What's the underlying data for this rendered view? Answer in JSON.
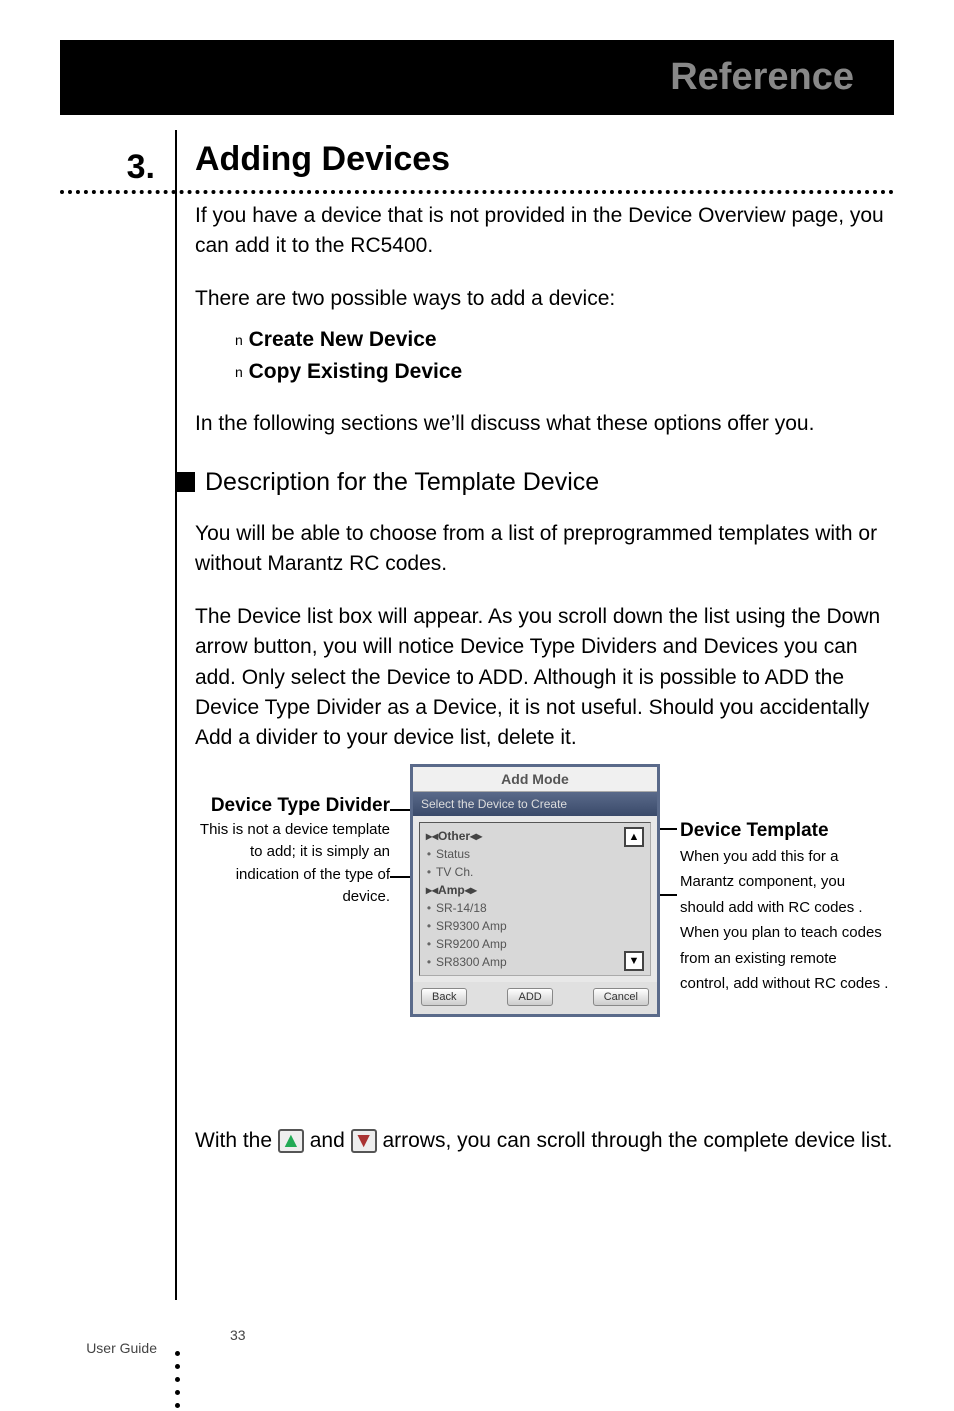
{
  "header": {
    "title": "Reference"
  },
  "section": {
    "number": "3.",
    "title": "Adding Devices",
    "intro": "If you have a device that is not provided in the Device Overview page, you can add it to the RC5400.",
    "ways_intro": "There are two possible ways to add a device:",
    "options": {
      "marker": "n",
      "opt1": "Create New Device",
      "opt2": "Copy Existing Device"
    },
    "follow": "In the following sections we’ll discuss what these options offer you.",
    "subheading": "Description for the Template Device",
    "sub_p1": "You will be able to choose from a list of preprogrammed templates  with  or  without  Marantz RC codes.",
    "sub_p2": "The Device list box will appear. As you scroll down the list using the Down arrow button, you will notice Device Type Dividers and Devices you can add. Only select the Device to ADD. Although it is possible to ADD the Device Type Divider as a Device, it is not useful. Should you accidentally Add a divider to your device list, delete it.",
    "callout_left": {
      "title": "Device Type Divider",
      "body": "This is not a device template to add; it is simply an indication of the type of device."
    },
    "callout_right": {
      "title": "Device Template",
      "body": "When you add this for a Marantz component, you should add  with RC codes . When you plan to teach codes from an existing remote control, add  without RC codes ."
    },
    "scroll_note_pre": "With the ",
    "scroll_note_mid": " and ",
    "scroll_note_post": "  arrows, you can scroll through the complete device list."
  },
  "screenshot": {
    "title": "Add Mode",
    "subtitle": "Select the Device to Create",
    "items": [
      {
        "text": "Other",
        "divider": true
      },
      {
        "text": "Status",
        "divider": false
      },
      {
        "text": "TV Ch.",
        "divider": false
      },
      {
        "text": "Amp",
        "divider": true
      },
      {
        "text": "SR-14/18",
        "divider": false
      },
      {
        "text": "SR9300 Amp",
        "divider": false
      },
      {
        "text": "SR9200 Amp",
        "divider": false
      },
      {
        "text": "SR8300 Amp",
        "divider": false
      }
    ],
    "up": "▲",
    "down": "▼",
    "buttons": {
      "back": "Back",
      "add": "ADD",
      "cancel": "Cancel"
    }
  },
  "icons": {
    "up_triangle": "▲",
    "down_triangle": "▼"
  },
  "footer": {
    "label": "User Guide",
    "page": "33"
  }
}
